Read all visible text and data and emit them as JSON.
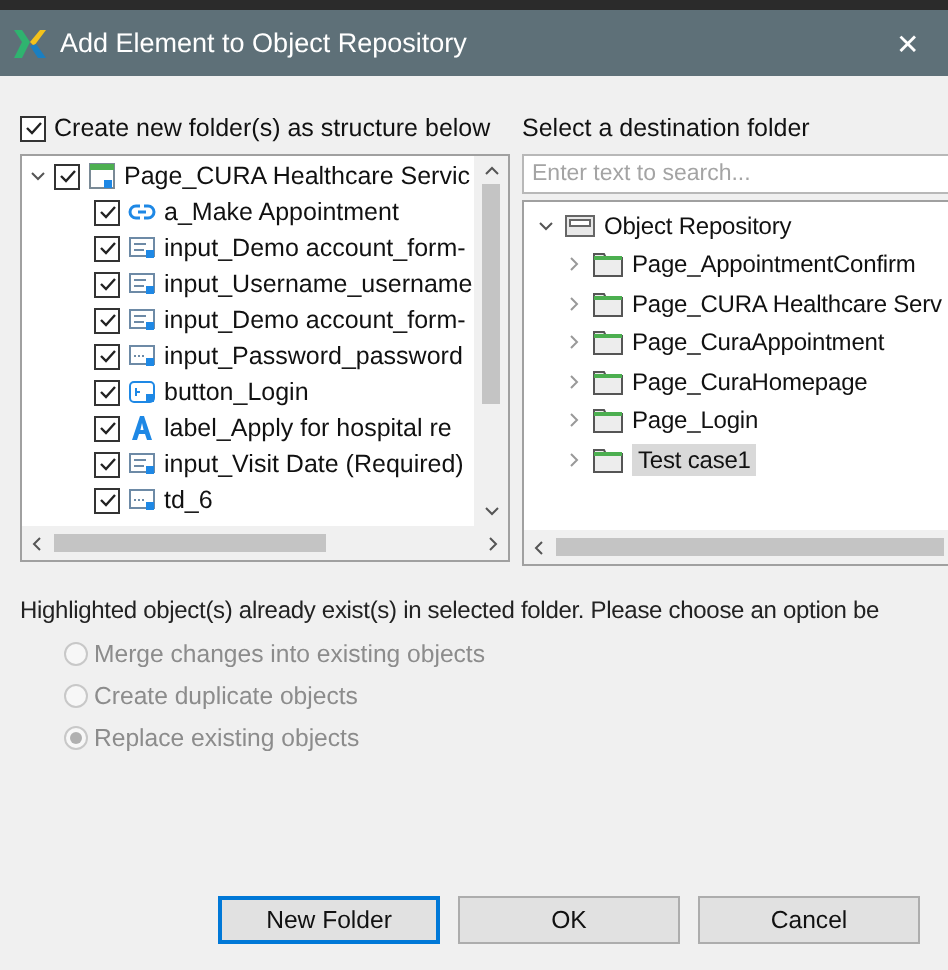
{
  "window": {
    "title": "Add Element to Object Repository",
    "close": "✕"
  },
  "create_folders": {
    "label": "Create new folder(s) as structure below",
    "checked": true
  },
  "element_tree": {
    "items": [
      {
        "label": "Page_CURA Healthcare Servic",
        "checked": true,
        "expanded": true,
        "kind": "page",
        "children": [
          {
            "label": "a_Make Appointment",
            "checked": true,
            "kind": "link"
          },
          {
            "label": "input_Demo account_form-",
            "checked": true,
            "kind": "input"
          },
          {
            "label": "input_Username_username",
            "checked": true,
            "kind": "input"
          },
          {
            "label": "input_Demo account_form-",
            "checked": true,
            "kind": "input"
          },
          {
            "label": "input_Password_password",
            "checked": true,
            "kind": "password"
          },
          {
            "label": "button_Login",
            "checked": true,
            "kind": "button"
          },
          {
            "label": "label_Apply for hospital re",
            "checked": true,
            "kind": "label"
          },
          {
            "label": "input_Visit Date (Required)",
            "checked": true,
            "kind": "input"
          },
          {
            "label": "td_6",
            "checked": true,
            "kind": "password"
          }
        ]
      }
    ]
  },
  "destination": {
    "label": "Select a destination folder",
    "search": {
      "placeholder": "Enter text to search..."
    },
    "tree": {
      "label": "Object Repository",
      "expanded": true,
      "children": [
        {
          "label": "Page_AppointmentConfirm",
          "expanded": false,
          "selected": false
        },
        {
          "label": "Page_CURA Healthcare Serv",
          "expanded": false,
          "selected": false
        },
        {
          "label": "Page_CuraAppointment",
          "expanded": false,
          "selected": false
        },
        {
          "label": "Page_CuraHomepage",
          "expanded": false,
          "selected": false
        },
        {
          "label": "Page_Login",
          "expanded": false,
          "selected": false
        },
        {
          "label": "Test case1",
          "expanded": false,
          "selected": true
        }
      ]
    }
  },
  "message": "Highlighted object(s) already exist(s) in selected folder. Please choose an option be",
  "options": [
    {
      "label": "Merge changes into existing objects",
      "selected": false,
      "disabled": true
    },
    {
      "label": "Create duplicate objects",
      "selected": false,
      "disabled": true
    },
    {
      "label": "Replace existing objects",
      "selected": true,
      "disabled": true
    }
  ],
  "buttons": [
    {
      "label": "New Folder",
      "default": true
    },
    {
      "label": "OK",
      "default": false
    },
    {
      "label": "Cancel",
      "default": false
    }
  ]
}
